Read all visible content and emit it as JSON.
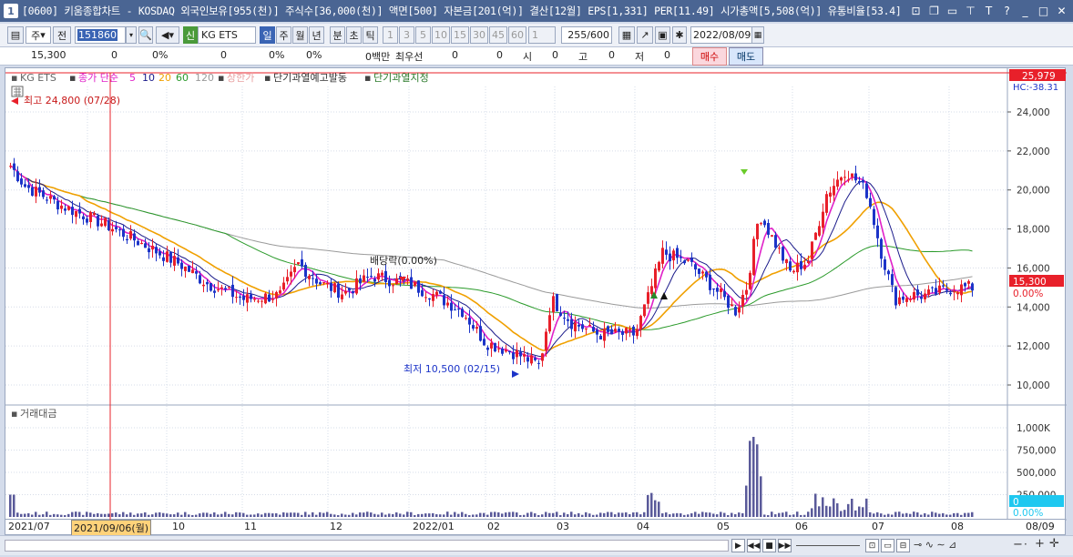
{
  "window": {
    "number": "1",
    "title": "[0600] 키움종합차트 - KOSDAQ 외국인보유[955(천)] 주식수[36,000(천)] 액면[500] 자본금[201(억)] 결산[12월] EPS[1,331] PER[11.49] 시가총액[5,508(억)] 유통비율[53.4]"
  },
  "toolbar": {
    "period_main": "주",
    "prev": "전",
    "code": "151860",
    "tag": "신",
    "name": "KG ETS",
    "periods": [
      "일",
      "주",
      "월",
      "년",
      "분",
      "초",
      "틱"
    ],
    "intervals": [
      "1",
      "3",
      "5",
      "10",
      "15",
      "30",
      "45",
      "60"
    ],
    "interval_value": "1",
    "count": "255",
    "count_total": "/600",
    "date": "2022/08/09"
  },
  "info": {
    "price": "15,300",
    "change": "0",
    "rate": "0%",
    "volume": "0",
    "vol_rate": "0%",
    "amt_rate": "0%",
    "amount": "0백만",
    "best_bid_label": "최우선",
    "best_bid": "0",
    "best_ask": "0",
    "open_label": "시",
    "open": "0",
    "high_label": "고",
    "high": "0",
    "low_label": "저",
    "low": "0",
    "buy": "매수",
    "sell": "매도"
  },
  "legend": {
    "name": "KG ETS",
    "ma": "종가 단순",
    "ma_periods": [
      "5",
      "10",
      "20",
      "60",
      "120"
    ],
    "upper": "상한가",
    "warn1": "단기과열예고발동",
    "warn2": "단기과열지정"
  },
  "annotations": {
    "high": "최고 24,800 (07/28)",
    "low": "최저 10,500 (02/15)",
    "dividend": "배당락(0.00%)",
    "hc": "HC:-38.31",
    "current_price": "15,300",
    "current_rate": "0.00%",
    "top_price": "25,979",
    "volume_title": "거래대금",
    "vol_zero": "0",
    "vol_zero_rate": "0.00%"
  },
  "price_axis": [
    "24,000",
    "22,000",
    "20,000",
    "18,000",
    "16,000",
    "14,000",
    "12,000",
    "10,000"
  ],
  "volume_axis": [
    "1,000K",
    "750,000",
    "500,000",
    "250,000"
  ],
  "time_axis": [
    "2021/07",
    "10",
    "11",
    "12",
    "2022/01",
    "02",
    "03",
    "04",
    "05",
    "06",
    "07",
    "08",
    "08/09"
  ],
  "cursor_date": "2021/09/06(월)",
  "colors": {
    "up": "#e8202a",
    "down": "#1c34c8",
    "ma5": "#e020c8",
    "ma10": "#1a1a8a",
    "ma20": "#f0a000",
    "ma60": "#2a9a2a",
    "ma120": "#9a9a9a"
  }
}
